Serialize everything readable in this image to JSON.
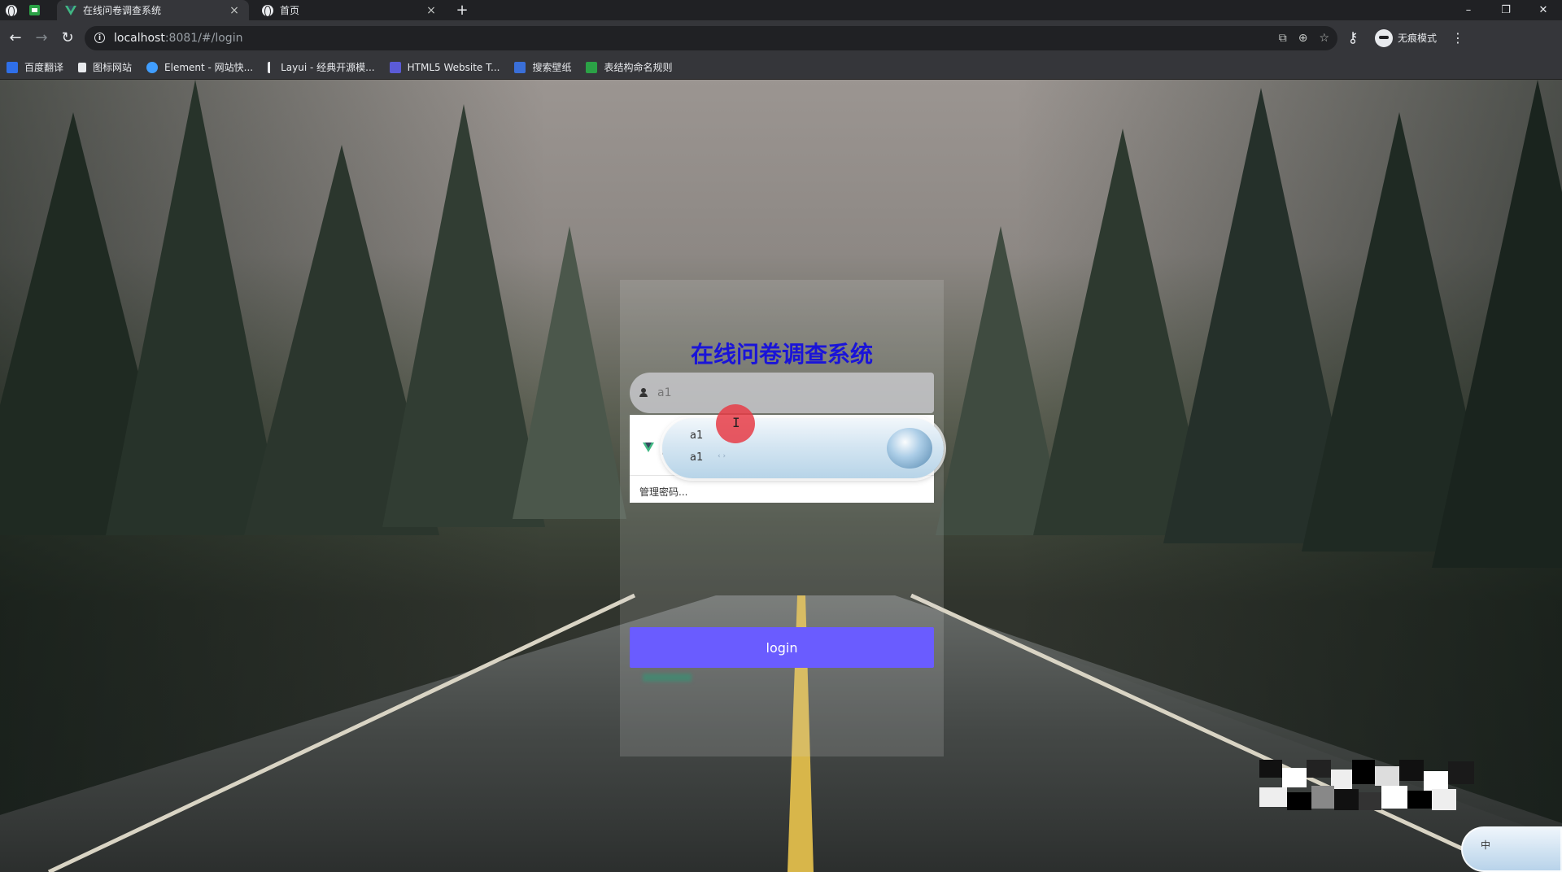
{
  "browser": {
    "tabs": [
      {
        "label": "在线问卷调查系统",
        "active": true,
        "icon": "vue-icon"
      },
      {
        "label": "首页",
        "active": false,
        "icon": "globe-icon"
      }
    ],
    "new_tab": "+",
    "url_host": "localhost",
    "url_path": ":8081/#/login",
    "profile_label": "无痕模式",
    "bookmarks": [
      {
        "label": "百度翻译",
        "color": "#2f6fe8"
      },
      {
        "label": "图标网站",
        "color": "#e8eaed"
      },
      {
        "label": "Element - 网站快...",
        "color": "#409eff"
      },
      {
        "label": "Layui - 经典开源模...",
        "color": "#e8eaed"
      },
      {
        "label": "HTML5 Website T...",
        "color": "#5b5bd6"
      },
      {
        "label": "搜索壁纸",
        "color": "#3a6fd8"
      },
      {
        "label": "表结构命名规则",
        "color": "#2ba246"
      }
    ]
  },
  "login": {
    "title": "在线问卷调查系统",
    "username_value": "a1",
    "panel_link": "管理密码...",
    "button_label": "login",
    "title_color": "#1a14d8",
    "button_color": "#6a5cff"
  },
  "autocomplete": {
    "items": [
      "a1",
      "a1"
    ]
  },
  "ime": {
    "label": "中"
  }
}
